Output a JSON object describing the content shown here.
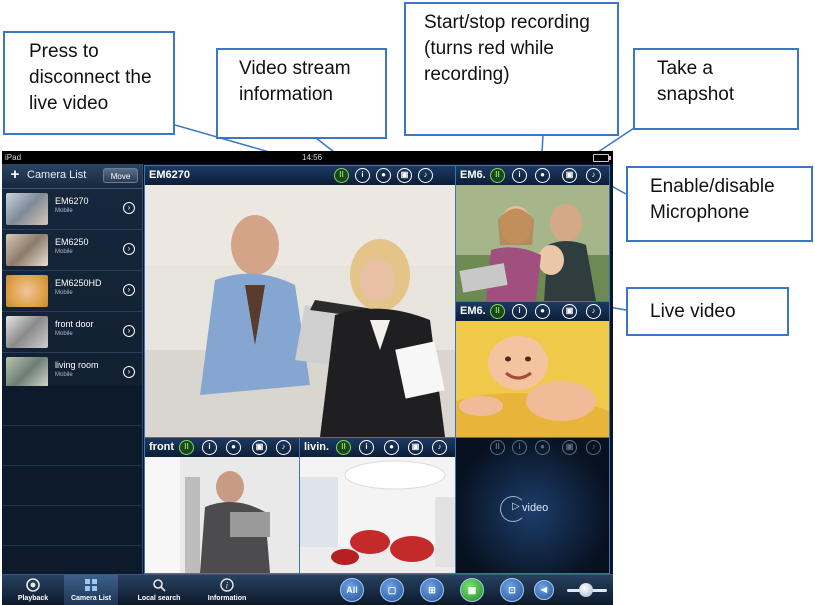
{
  "callouts": {
    "disconnect": "Press to disconnect the live video",
    "stream_info": "Video stream information",
    "record": "Start/stop recording (turns red while recording)",
    "snapshot": "Take a snapshot",
    "microphone": "Enable/disable Microphone",
    "live_video": "Live video"
  },
  "status_bar": {
    "device": "iPad",
    "time": "14:56"
  },
  "sidebar": {
    "add_label": "+",
    "title": "Camera List",
    "move_label": "Move",
    "cameras": [
      {
        "name": "EM6270",
        "subtitle": "Mobile"
      },
      {
        "name": "EM6250",
        "subtitle": "Mobile"
      },
      {
        "name": "EM6250HD",
        "subtitle": "Mobile"
      },
      {
        "name": "front door",
        "subtitle": "Mobile"
      },
      {
        "name": "living room",
        "subtitle": "Mobile"
      }
    ]
  },
  "panels": {
    "main": "EM6270",
    "top_right": "EM6.",
    "mid_right": "EM6.",
    "bottom_left": "front",
    "bottom_mid": "livin.",
    "empty_label": "video"
  },
  "toolbar_icon_names": [
    "disconnect-icon",
    "info-icon",
    "record-icon",
    "snapshot-icon",
    "microphone-icon"
  ],
  "bottom_tabs": [
    "Playback",
    "Camera List",
    "Local search",
    "Information"
  ],
  "layout_buttons": {
    "all": "All"
  },
  "colors": {
    "accent": "#3a78c6",
    "active_green": "#7ddc4e",
    "background": "#0b1626"
  }
}
